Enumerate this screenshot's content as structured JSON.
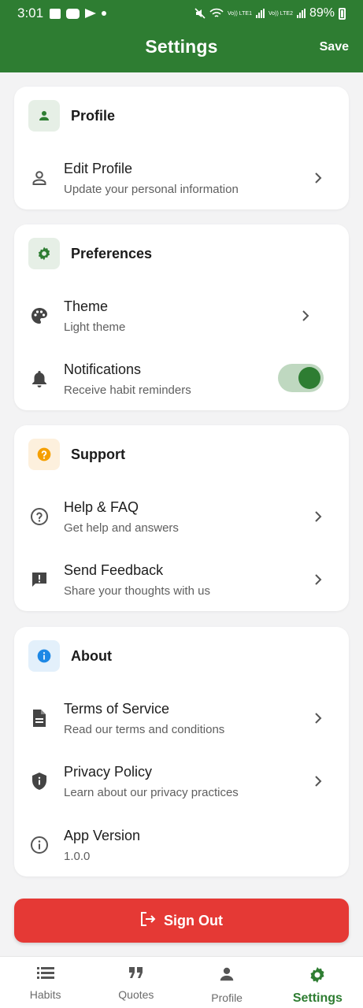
{
  "status_bar": {
    "time": "3:01",
    "battery": "89%",
    "sim1": "Vo)) LTE1",
    "sim2": "Vo)) LTE2"
  },
  "app_bar": {
    "title": "Settings",
    "save_label": "Save"
  },
  "sections": {
    "profile": {
      "title": "Profile",
      "header_icon": "person-icon",
      "items": [
        {
          "title": "Edit Profile",
          "subtitle": "Update your personal information",
          "icon": "person-outline-icon"
        }
      ]
    },
    "preferences": {
      "title": "Preferences",
      "header_icon": "gear-icon",
      "items": [
        {
          "title": "Theme",
          "subtitle": "Light theme",
          "icon": "palette-icon"
        },
        {
          "title": "Notifications",
          "subtitle": "Receive habit reminders",
          "icon": "bell-icon",
          "toggle_on": true
        }
      ]
    },
    "support": {
      "title": "Support",
      "header_icon": "help-icon",
      "items": [
        {
          "title": "Help & FAQ",
          "subtitle": "Get help and answers",
          "icon": "help-outline-icon"
        },
        {
          "title": "Send Feedback",
          "subtitle": "Share your thoughts with us",
          "icon": "feedback-icon"
        }
      ]
    },
    "about": {
      "title": "About",
      "header_icon": "info-icon",
      "items": [
        {
          "title": "Terms of Service",
          "subtitle": "Read our terms and conditions",
          "icon": "document-icon"
        },
        {
          "title": "Privacy Policy",
          "subtitle": "Learn about our privacy practices",
          "icon": "shield-icon"
        },
        {
          "title": "App Version",
          "subtitle": "1.0.0",
          "icon": "info-outline-icon"
        }
      ]
    }
  },
  "sign_out": {
    "label": "Sign Out",
    "icon": "logout-icon"
  },
  "bottom_nav": {
    "items": [
      {
        "label": "Habits",
        "icon": "list-icon"
      },
      {
        "label": "Quotes",
        "icon": "quote-icon"
      },
      {
        "label": "Profile",
        "icon": "person-icon"
      },
      {
        "label": "Settings",
        "icon": "gear-icon",
        "active": true
      }
    ]
  },
  "colors": {
    "primary": "#2e7d32",
    "danger": "#e53935",
    "support_accent": "#f59f00",
    "about_accent": "#1e88e5",
    "background": "#f3f3f4"
  }
}
